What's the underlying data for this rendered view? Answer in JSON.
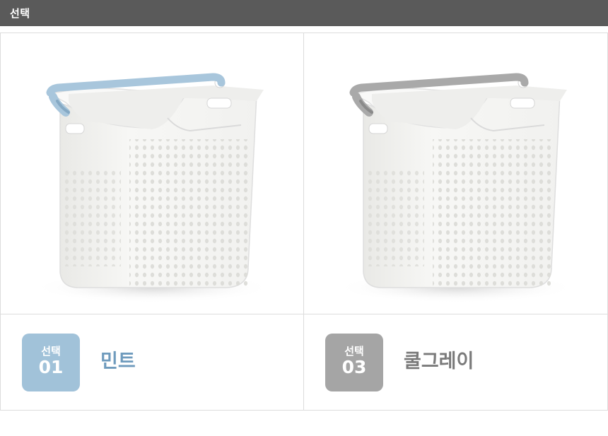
{
  "header": {
    "title": "선택"
  },
  "options": [
    {
      "badge_word": "선택",
      "badge_number": "01",
      "name": "민트",
      "badge_color": "#a1c2d9",
      "name_color": "#6f9bbd",
      "handle_color": "#a8c6dc",
      "handle_shade": "#85a9c4"
    },
    {
      "badge_word": "선택",
      "badge_number": "03",
      "name": "쿨그레이",
      "badge_color": "#a5a5a5",
      "name_color": "#7a7a7a",
      "handle_color": "#a9a9a9",
      "handle_shade": "#8a8a8a"
    }
  ]
}
